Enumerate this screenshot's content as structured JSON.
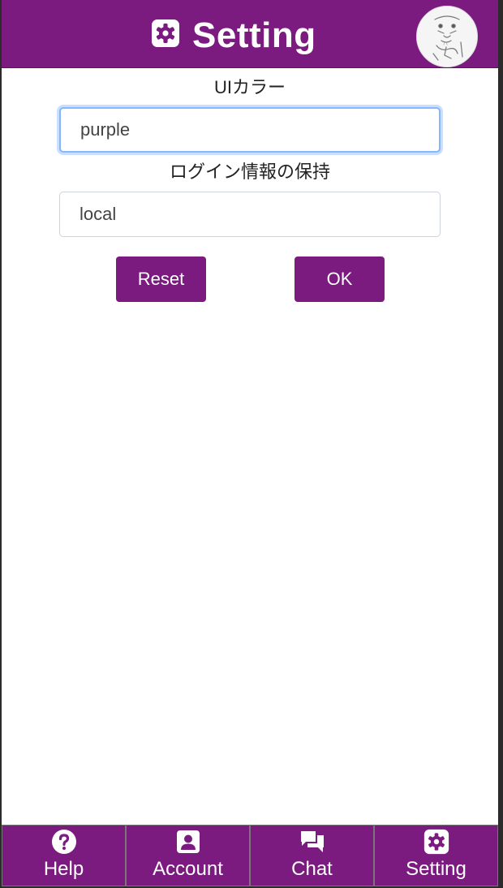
{
  "header": {
    "title": "Setting",
    "icon": "gear-icon",
    "background": "#7b1a7f"
  },
  "form": {
    "ui_color": {
      "label": "UIカラー",
      "value": "purple"
    },
    "login_retention": {
      "label": "ログイン情報の保持",
      "value": "local"
    },
    "reset_label": "Reset",
    "ok_label": "OK"
  },
  "nav": {
    "items": [
      {
        "label": "Help",
        "icon": "question-circle-icon"
      },
      {
        "label": "Account",
        "icon": "person-square-icon"
      },
      {
        "label": "Chat",
        "icon": "chat-bubbles-icon"
      },
      {
        "label": "Setting",
        "icon": "gear-icon"
      }
    ]
  },
  "colors": {
    "accent": "#7b1a7f",
    "focus_ring": "#86b7fe"
  }
}
